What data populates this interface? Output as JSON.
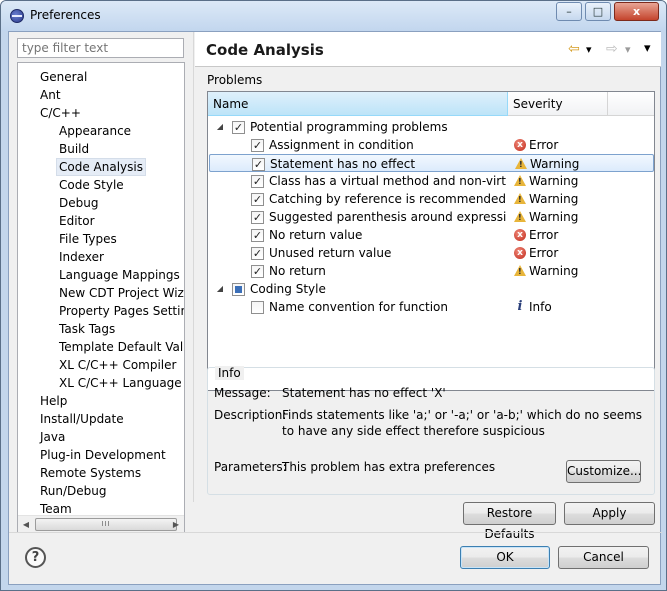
{
  "window": {
    "title": "Preferences",
    "controls": {
      "minimize": "–",
      "maximize": "□",
      "close": "x"
    }
  },
  "filter": {
    "placeholder": "type filter text"
  },
  "tree": [
    {
      "label": "General",
      "indent": 0
    },
    {
      "label": "Ant",
      "indent": 0
    },
    {
      "label": "C/C++",
      "indent": 0
    },
    {
      "label": "Appearance",
      "indent": 1
    },
    {
      "label": "Build",
      "indent": 1
    },
    {
      "label": "Code Analysis",
      "indent": 1,
      "selected": true
    },
    {
      "label": "Code Style",
      "indent": 1
    },
    {
      "label": "Debug",
      "indent": 1
    },
    {
      "label": "Editor",
      "indent": 1
    },
    {
      "label": "File Types",
      "indent": 1
    },
    {
      "label": "Indexer",
      "indent": 1
    },
    {
      "label": "Language Mappings",
      "indent": 1
    },
    {
      "label": "New CDT Project Wizar",
      "indent": 1
    },
    {
      "label": "Property Pages Settings",
      "indent": 1
    },
    {
      "label": "Task Tags",
      "indent": 1
    },
    {
      "label": "Template Default Value",
      "indent": 1
    },
    {
      "label": "XL C/C++ Compiler",
      "indent": 1
    },
    {
      "label": "XL C/C++ Language Op",
      "indent": 1
    },
    {
      "label": "Help",
      "indent": 0
    },
    {
      "label": "Install/Update",
      "indent": 0
    },
    {
      "label": "Java",
      "indent": 0
    },
    {
      "label": "Plug-in Development",
      "indent": 0
    },
    {
      "label": "Remote Systems",
      "indent": 0
    },
    {
      "label": "Run/Debug",
      "indent": 0
    },
    {
      "label": "Team",
      "indent": 0
    }
  ],
  "page": {
    "title": "Code Analysis",
    "problems_label": "Problems"
  },
  "table": {
    "columns": [
      "Name",
      "Severity"
    ],
    "rows": [
      {
        "kind": "category",
        "label": "Potential programming problems",
        "state": "checked",
        "expanded": true
      },
      {
        "kind": "problem",
        "label": "Assignment in condition",
        "checked": true,
        "severity": "Error",
        "sev": "error"
      },
      {
        "kind": "problem",
        "label": "Statement has no effect",
        "checked": true,
        "severity": "Warning",
        "sev": "warning",
        "selected": true
      },
      {
        "kind": "problem",
        "label": "Class has a virtual method and non-virtual de",
        "checked": true,
        "severity": "Warning",
        "sev": "warning"
      },
      {
        "kind": "problem",
        "label": "Catching by reference is recommended",
        "checked": true,
        "severity": "Warning",
        "sev": "warning"
      },
      {
        "kind": "problem",
        "label": "Suggested parenthesis around expression",
        "checked": true,
        "severity": "Warning",
        "sev": "warning"
      },
      {
        "kind": "problem",
        "label": "No return value",
        "checked": true,
        "severity": "Error",
        "sev": "error"
      },
      {
        "kind": "problem",
        "label": "Unused return value",
        "checked": true,
        "severity": "Error",
        "sev": "error"
      },
      {
        "kind": "problem",
        "label": "No return",
        "checked": true,
        "severity": "Warning",
        "sev": "warning"
      },
      {
        "kind": "category",
        "label": "Coding Style",
        "state": "partial",
        "expanded": true
      },
      {
        "kind": "problem",
        "label": "Name convention for function",
        "checked": false,
        "severity": "Info",
        "sev": "info"
      }
    ]
  },
  "info": {
    "legend": "Info",
    "message_label": "Message:",
    "message_value": "Statement has no effect 'X'",
    "description_label": "Description:",
    "description_value": "Finds statements like 'a;' or '-a;' or 'a-b;' which do no seems to have any side effect therefore suspicious",
    "parameters_label": "Parameters:",
    "parameters_value": "This problem has extra preferences",
    "customize_button": "Customize..."
  },
  "buttons": {
    "restore_defaults": "Restore Defaults",
    "apply": "Apply",
    "ok": "OK",
    "cancel": "Cancel"
  },
  "icons": {
    "help": "?",
    "back": "⇦",
    "forward": "⇨",
    "dropdown": "▾",
    "scroll_grip": "III",
    "check": "✓",
    "expanded": "◢",
    "scroll_left": "◀",
    "scroll_right": "▶"
  }
}
